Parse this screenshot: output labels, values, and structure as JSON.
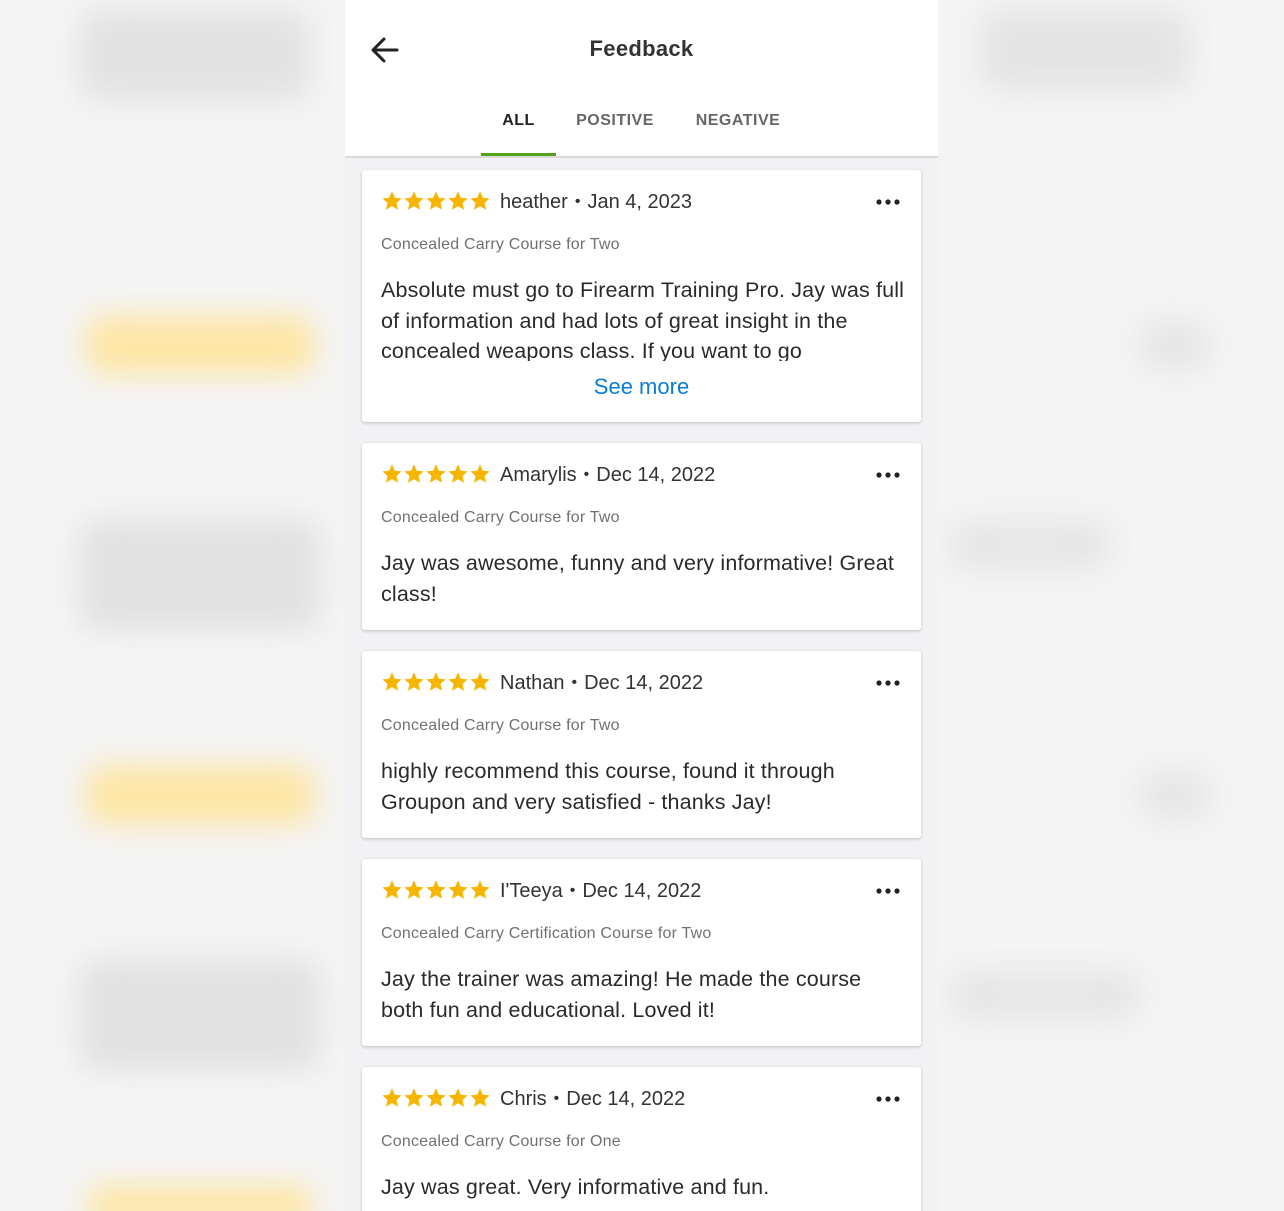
{
  "header": {
    "title": "Feedback"
  },
  "tabs": [
    {
      "label": "ALL",
      "active": true
    },
    {
      "label": "POSITIVE",
      "active": false
    },
    {
      "label": "NEGATIVE",
      "active": false
    }
  ],
  "colors": {
    "accent": "#53a318",
    "star": "#f7b500",
    "link": "#0a7bd1"
  },
  "icons": {
    "back": "arrow-left-icon",
    "more": "more-horizontal-icon",
    "star": "star-icon"
  },
  "reviews": [
    {
      "rating": 5,
      "reviewer": "heather",
      "separator": "•",
      "date": "Jan 4, 2023",
      "course": "Concealed Carry Course for Two",
      "text": "Absolute must go to Firearm Training Pro. Jay was full of information and had lots of great insight in the concealed weapons class. If you want to go",
      "see_more": "See more"
    },
    {
      "rating": 5,
      "reviewer": "Amarylis",
      "separator": "•",
      "date": "Dec 14, 2022",
      "course": "Concealed Carry Course for Two",
      "text": "Jay was awesome, funny and very informative! Great class!"
    },
    {
      "rating": 5,
      "reviewer": "Nathan",
      "separator": "•",
      "date": "Dec 14, 2022",
      "course": "Concealed Carry Course for Two",
      "text": "highly recommend this course, found it through Groupon and very satisfied - thanks Jay!"
    },
    {
      "rating": 5,
      "reviewer": "I'Teeya",
      "separator": "•",
      "date": "Dec 14, 2022",
      "course": "Concealed Carry Certification Course for Two",
      "text": "Jay the trainer was amazing! He made the course both fun and educational. Loved it!"
    },
    {
      "rating": 5,
      "reviewer": "Chris",
      "separator": "•",
      "date": "Dec 14, 2022",
      "course": "Concealed Carry Course for One",
      "text": "Jay was great. Very informative and fun."
    }
  ]
}
